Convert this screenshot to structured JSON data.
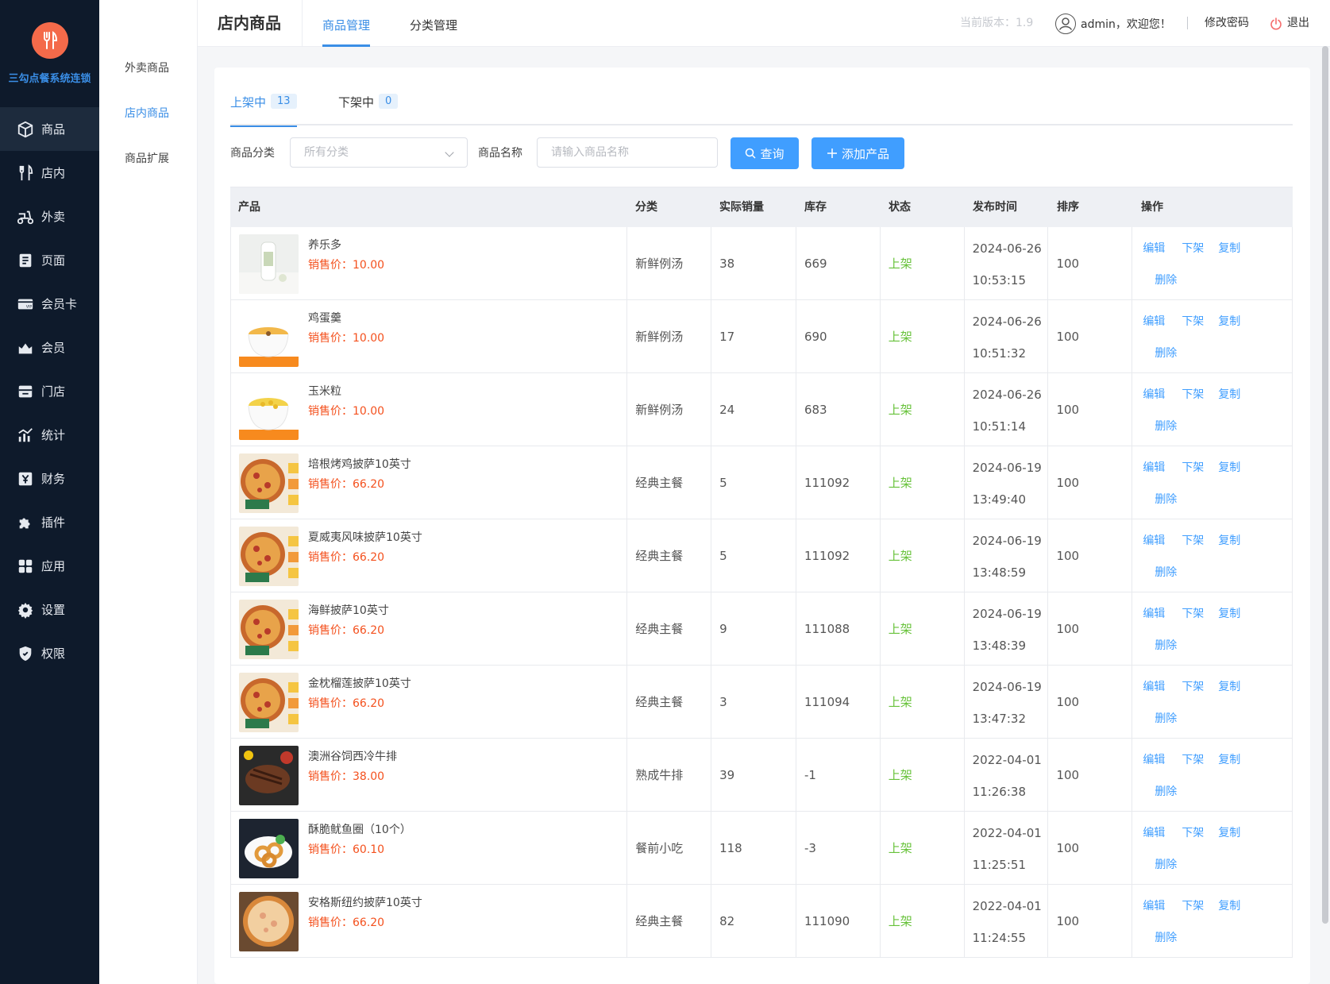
{
  "brand": {
    "name": "三勾点餐系统连锁",
    "logo_color": "#f46a4a"
  },
  "sidebar": {
    "items": [
      {
        "label": "商品",
        "icon": "box-icon",
        "active": true
      },
      {
        "label": "店内",
        "icon": "fork-knife-icon",
        "active": false
      },
      {
        "label": "外卖",
        "icon": "scooter-icon",
        "active": false
      },
      {
        "label": "页面",
        "icon": "page-icon",
        "active": false
      },
      {
        "label": "会员卡",
        "icon": "vip-card-icon",
        "active": false
      },
      {
        "label": "会员",
        "icon": "crown-icon",
        "active": false
      },
      {
        "label": "门店",
        "icon": "store-icon",
        "active": false
      },
      {
        "label": "统计",
        "icon": "chart-icon",
        "active": false
      },
      {
        "label": "财务",
        "icon": "finance-icon",
        "active": false
      },
      {
        "label": "插件",
        "icon": "puzzle-icon",
        "active": false
      },
      {
        "label": "应用",
        "icon": "apps-icon",
        "active": false
      },
      {
        "label": "设置",
        "icon": "gear-icon",
        "active": false
      },
      {
        "label": "权限",
        "icon": "shield-icon",
        "active": false
      }
    ]
  },
  "submenu": {
    "items": [
      {
        "label": "外卖商品",
        "active": false
      },
      {
        "label": "店内商品",
        "active": true
      },
      {
        "label": "商品扩展",
        "active": false
      }
    ]
  },
  "header": {
    "title": "店内商品",
    "tabs": [
      {
        "label": "商品管理",
        "active": true
      },
      {
        "label": "分类管理",
        "active": false
      }
    ],
    "version": "当前版本：1.9",
    "user_greeting": "admin，欢迎您！",
    "change_password": "修改密码",
    "logout": "退出"
  },
  "status_tabs": [
    {
      "label": "上架中",
      "count": "13",
      "active": true
    },
    {
      "label": "下架中",
      "count": "0",
      "active": false
    }
  ],
  "filters": {
    "category_label": "商品分类",
    "category_placeholder": "所有分类",
    "name_label": "商品名称",
    "name_placeholder": "请输入商品名称",
    "search_button": "查询",
    "add_button": "添加产品"
  },
  "table": {
    "columns": [
      "产品",
      "分类",
      "实际销量",
      "库存",
      "状态",
      "发布时间",
      "排序",
      "操作"
    ],
    "op_labels": {
      "edit": "编辑",
      "offshelf": "下架",
      "copy": "复制",
      "delete": "删除"
    },
    "rows": [
      {
        "name": "养乐多",
        "price": "销售价：10.00",
        "category": "新鲜例汤",
        "sales": "38",
        "stock": "669",
        "status": "上架",
        "date": "2024-06-26",
        "time": "10:53:15",
        "sort": "100",
        "thumb": "yakult"
      },
      {
        "name": "鸡蛋羹",
        "price": "销售价：10.00",
        "category": "新鲜例汤",
        "sales": "17",
        "stock": "690",
        "status": "上架",
        "date": "2024-06-26",
        "time": "10:51:32",
        "sort": "100",
        "thumb": "custard"
      },
      {
        "name": "玉米粒",
        "price": "销售价：10.00",
        "category": "新鲜例汤",
        "sales": "24",
        "stock": "683",
        "status": "上架",
        "date": "2024-06-26",
        "time": "10:51:14",
        "sort": "100",
        "thumb": "corn"
      },
      {
        "name": "培根烤鸡披萨10英寸",
        "price": "销售价：66.20",
        "category": "经典主餐",
        "sales": "5",
        "stock": "111092",
        "status": "上架",
        "date": "2024-06-19",
        "time": "13:49:40",
        "sort": "100",
        "thumb": "pizza"
      },
      {
        "name": "夏威夷风味披萨10英寸",
        "price": "销售价：66.20",
        "category": "经典主餐",
        "sales": "5",
        "stock": "111092",
        "status": "上架",
        "date": "2024-06-19",
        "time": "13:48:59",
        "sort": "100",
        "thumb": "pizza"
      },
      {
        "name": "海鲜披萨10英寸",
        "price": "销售价：66.20",
        "category": "经典主餐",
        "sales": "9",
        "stock": "111088",
        "status": "上架",
        "date": "2024-06-19",
        "time": "13:48:39",
        "sort": "100",
        "thumb": "pizza"
      },
      {
        "name": "金枕榴莲披萨10英寸",
        "price": "销售价：66.20",
        "category": "经典主餐",
        "sales": "3",
        "stock": "111094",
        "status": "上架",
        "date": "2024-06-19",
        "time": "13:47:32",
        "sort": "100",
        "thumb": "pizza"
      },
      {
        "name": "澳洲谷饲西冷牛排",
        "price": "销售价：38.00",
        "category": "熟成牛排",
        "sales": "39",
        "stock": "-1",
        "status": "上架",
        "date": "2022-04-01",
        "time": "11:26:38",
        "sort": "100",
        "thumb": "steak"
      },
      {
        "name": "酥脆鱿鱼圈（10个）",
        "price": "销售价：60.10",
        "category": "餐前小吃",
        "sales": "118",
        "stock": "-3",
        "status": "上架",
        "date": "2022-04-01",
        "time": "11:25:51",
        "sort": "100",
        "thumb": "squid"
      },
      {
        "name": "安格斯纽约披萨10英寸",
        "price": "销售价：66.20",
        "category": "经典主餐",
        "sales": "82",
        "stock": "111090",
        "status": "上架",
        "date": "2022-04-01",
        "time": "11:24:55",
        "sort": "100",
        "thumb": "pizza2"
      }
    ]
  }
}
